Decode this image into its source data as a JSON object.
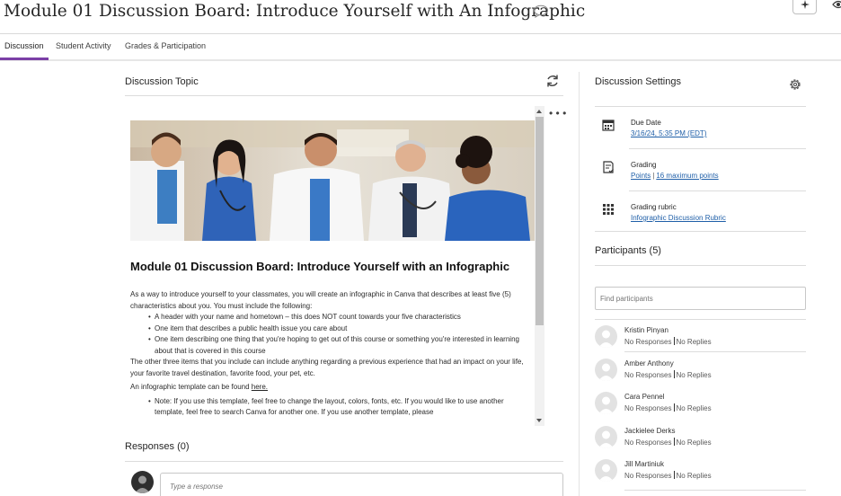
{
  "header": {
    "title": "Module 01 Discussion Board: Introduce Yourself with An Infographic"
  },
  "tabs": [
    {
      "label": "Discussion",
      "active": true
    },
    {
      "label": "Student Activity",
      "active": false
    },
    {
      "label": "Grades & Participation",
      "active": false
    }
  ],
  "topic": {
    "section_title": "Discussion Topic",
    "heading": "Module 01 Discussion Board: Introduce Yourself with an Infographic",
    "intro": "As a way to introduce yourself to your classmates, you will create an infographic in Canva that describes at least five (5) characteristics about you. You must include the following:",
    "bullets": [
      "A header with your name and hometown – this does NOT count towards your five characteristics",
      "One item that describes a public health issue you care about",
      "One item describing one thing that you're hoping to get out of this course or something you're interested in learning about that is covered in this course"
    ],
    "other_items": "The other three items that you include can include anything regarding a previous experience that had an impact on your life, your favorite travel destination, favorite food, your pet, etc.",
    "template_text": "An infographic template can be found",
    "template_link": "here.",
    "note": "Note: If you use this template, feel free to change the layout, colors, fonts, etc. If you would like to use another template, feel free to search Canva for another one. If you use another template, please"
  },
  "responses": {
    "title": "Responses (0)",
    "placeholder": "Type a response"
  },
  "settings": {
    "title": "Discussion Settings",
    "due_label": "Due Date",
    "due_value": "3/16/24, 5:35 PM (EDT)",
    "grading_label": "Grading",
    "grading_type": "Points",
    "grading_max": "16 maximum points",
    "rubric_label": "Grading rubric",
    "rubric_value": "Infographic Discussion Rubric"
  },
  "participants": {
    "title": "Participants (5)",
    "search_placeholder": "Find participants",
    "list": [
      {
        "name": "Kristin Pinyan",
        "responses": "No Responses",
        "replies": "No Replies"
      },
      {
        "name": "Amber Anthony",
        "responses": "No Responses",
        "replies": "No Replies"
      },
      {
        "name": "Cara Pennel",
        "responses": "No Responses",
        "replies": "No Replies"
      },
      {
        "name": "Jackielee Derks",
        "responses": "No Responses",
        "replies": "No Replies"
      },
      {
        "name": "Jill Martiniuk",
        "responses": "No Responses",
        "replies": "No Replies"
      }
    ]
  },
  "colors": {
    "accent": "#7b3fa6",
    "link": "#1f5fa8"
  }
}
